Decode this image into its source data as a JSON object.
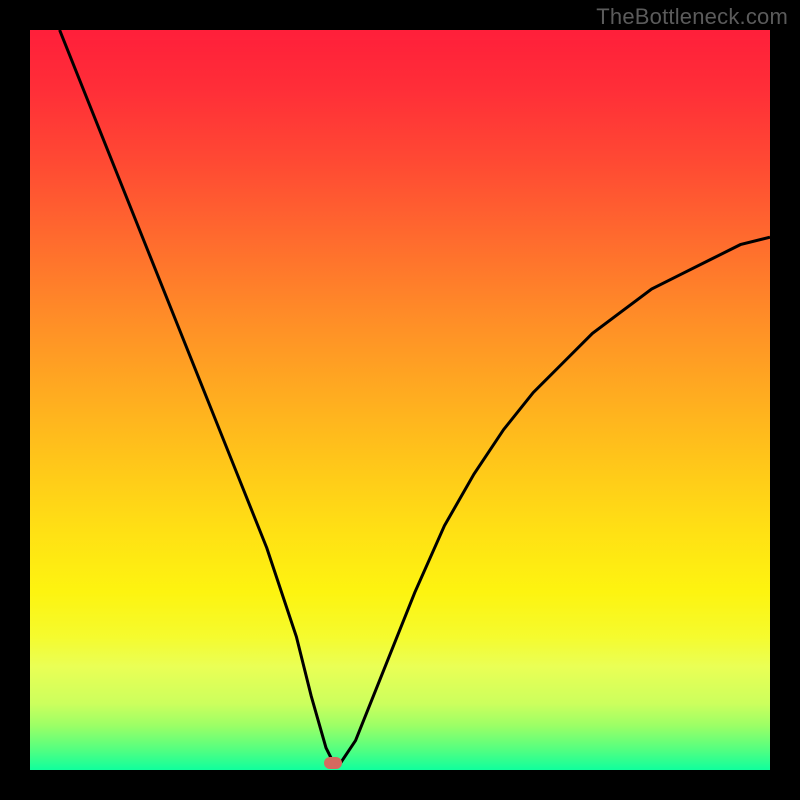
{
  "watermark": "TheBottleneck.com",
  "chart_data": {
    "type": "line",
    "title": "",
    "xlabel": "",
    "ylabel": "",
    "xlim": [
      0,
      100
    ],
    "ylim": [
      0,
      100
    ],
    "background_gradient": {
      "top_color": "#ff1f3a",
      "bottom_color": "#10ff9d",
      "meaning": "high value (top) = bottleneck/bad (red), low value (bottom) = balanced/good (green)"
    },
    "series": [
      {
        "name": "bottleneck-curve",
        "x": [
          4,
          8,
          12,
          16,
          20,
          24,
          28,
          32,
          36,
          38,
          40,
          41,
          42,
          44,
          48,
          52,
          56,
          60,
          64,
          68,
          72,
          76,
          80,
          84,
          88,
          92,
          96,
          100
        ],
        "y": [
          100,
          90,
          80,
          70,
          60,
          50,
          40,
          30,
          18,
          10,
          3,
          1,
          1,
          4,
          14,
          24,
          33,
          40,
          46,
          51,
          55,
          59,
          62,
          65,
          67,
          69,
          71,
          72
        ]
      }
    ],
    "marker": {
      "name": "minimum-point",
      "x": 41,
      "y": 1,
      "color": "#d46a5f"
    },
    "grid": false,
    "legend": false
  }
}
